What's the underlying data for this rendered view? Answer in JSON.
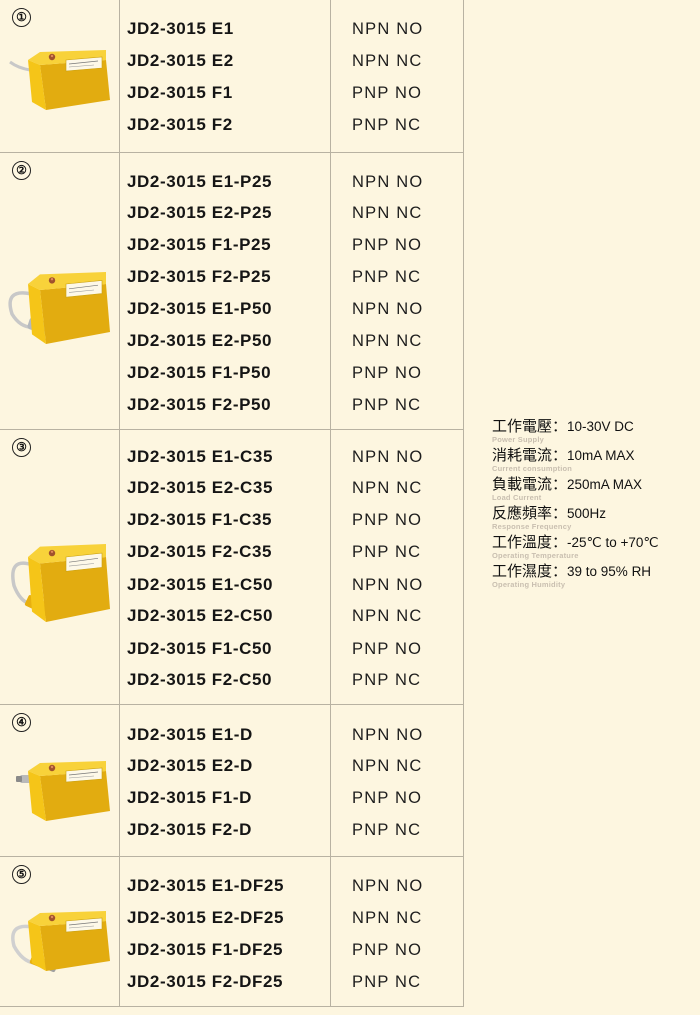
{
  "groups": [
    {
      "num": "①",
      "sensor": "sensor-with-lead",
      "rows": [
        {
          "model": "JD2-3015 E1",
          "type": "NPN NO"
        },
        {
          "model": "JD2-3015 E2",
          "type": "NPN NC"
        },
        {
          "model": "JD2-3015 F1",
          "type": "PNP NO"
        },
        {
          "model": "JD2-3015 F2",
          "type": "PNP NC"
        }
      ]
    },
    {
      "num": "②",
      "sensor": "sensor-with-p-plug",
      "rows": [
        {
          "model": "JD2-3015 E1-P25",
          "type": "NPN NO"
        },
        {
          "model": "JD2-3015 E2-P25",
          "type": "NPN NC"
        },
        {
          "model": "JD2-3015 F1-P25",
          "type": "PNP NO"
        },
        {
          "model": "JD2-3015 F2-P25",
          "type": "PNP NC"
        },
        {
          "model": "JD2-3015 E1-P50",
          "type": "NPN NO"
        },
        {
          "model": "JD2-3015 E2-P50",
          "type": "NPN NC"
        },
        {
          "model": "JD2-3015 F1-P50",
          "type": "PNP NO"
        },
        {
          "model": "JD2-3015 F2-P50",
          "type": "PNP NC"
        }
      ]
    },
    {
      "num": "③",
      "sensor": "sensor-with-c-connector",
      "rows": [
        {
          "model": "JD2-3015 E1-C35",
          "type": "NPN NO"
        },
        {
          "model": "JD2-3015 E2-C35",
          "type": "NPN NC"
        },
        {
          "model": "JD2-3015 F1-C35",
          "type": "PNP NO"
        },
        {
          "model": "JD2-3015 F2-C35",
          "type": "PNP NC"
        },
        {
          "model": "JD2-3015 E1-C50",
          "type": "NPN NO"
        },
        {
          "model": "JD2-3015 E2-C50",
          "type": "NPN NC"
        },
        {
          "model": "JD2-3015 F1-C50",
          "type": "PNP NO"
        },
        {
          "model": "JD2-3015 F2-C50",
          "type": "PNP NC"
        }
      ]
    },
    {
      "num": "④",
      "sensor": "sensor-with-d-connector",
      "rows": [
        {
          "model": "JD2-3015 E1-D",
          "type": "NPN NO"
        },
        {
          "model": "JD2-3015 E2-D",
          "type": "NPN NC"
        },
        {
          "model": "JD2-3015 F1-D",
          "type": "PNP NO"
        },
        {
          "model": "JD2-3015 F2-D",
          "type": "PNP NC"
        }
      ]
    },
    {
      "num": "⑤",
      "sensor": "sensor-with-df-cable",
      "rows": [
        {
          "model": "JD2-3015 E1-DF25",
          "type": "NPN NO"
        },
        {
          "model": "JD2-3015 E2-DF25",
          "type": "NPN NC"
        },
        {
          "model": "JD2-3015 F1-DF25",
          "type": "PNP NO"
        },
        {
          "model": "JD2-3015 F2-DF25",
          "type": "PNP NC"
        }
      ]
    }
  ],
  "specs": [
    {
      "label": "工作電壓：",
      "value": "10-30V DC",
      "en": "Power Supply"
    },
    {
      "label": "消耗電流：",
      "value": "10mA MAX",
      "en": "Current consumption"
    },
    {
      "label": "負載電流：",
      "value": "250mA MAX",
      "en": "Load Current"
    },
    {
      "label": "反應頻率：",
      "value": "500Hz",
      "en": "Response Frequency"
    },
    {
      "label": "工作溫度：",
      "value": "-25℃ to +70℃",
      "en": "Operating Temperature"
    },
    {
      "label": "工作濕度：",
      "value": "39 to 95% RH",
      "en": "Operating Humidity"
    }
  ],
  "colors": {
    "background": "#fdf6e0",
    "grid_line": "#b8b2a2",
    "sensor_body": "#f5c518",
    "sensor_face": "#e2ac10",
    "spec_english": "#c9bfb0"
  }
}
